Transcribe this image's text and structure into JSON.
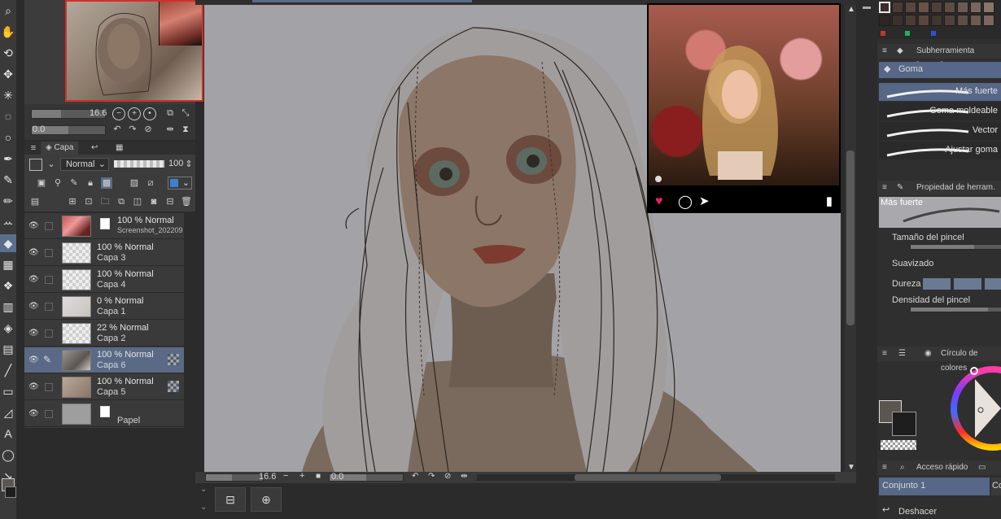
{
  "toolbar": {
    "tools": [
      {
        "name": "zoom-icon",
        "glyph": "⌕"
      },
      {
        "name": "hand-icon",
        "glyph": "✋"
      },
      {
        "name": "rotate-icon",
        "glyph": "⟲"
      },
      {
        "name": "move-icon",
        "glyph": "✥"
      },
      {
        "name": "sparkle-icon",
        "glyph": "✳"
      },
      {
        "name": "lasso-icon",
        "glyph": "◌"
      },
      {
        "name": "ellipse-select-icon",
        "glyph": "○"
      },
      {
        "name": "eyedropper-icon",
        "glyph": "✒"
      },
      {
        "name": "pen-icon",
        "glyph": "✎"
      },
      {
        "name": "pencil-icon",
        "glyph": "✏"
      },
      {
        "name": "brush-icon",
        "glyph": "ꕀ"
      },
      {
        "name": "eraser-icon",
        "glyph": "◆"
      },
      {
        "name": "blend-icon",
        "glyph": "▦"
      },
      {
        "name": "decoration-icon",
        "glyph": "❖"
      },
      {
        "name": "airbrush-icon",
        "glyph": "▥"
      },
      {
        "name": "fill-icon",
        "glyph": "◈"
      },
      {
        "name": "gradient-icon",
        "glyph": "▤"
      },
      {
        "name": "line-icon",
        "glyph": "╱"
      },
      {
        "name": "frame-icon",
        "glyph": "▭"
      },
      {
        "name": "ruler-icon",
        "glyph": "◿"
      },
      {
        "name": "text-icon",
        "glyph": "A"
      },
      {
        "name": "balloon-icon",
        "glyph": "◯"
      },
      {
        "name": "correct-line-icon",
        "glyph": "↘"
      }
    ]
  },
  "navigator": {
    "zoom_value": "16.6",
    "rotation_value": "0.0"
  },
  "layer_panel": {
    "tab_label": "Capa",
    "blend_mode": "Normal",
    "opacity": "100"
  },
  "layers": [
    {
      "line1": "100 % Normal",
      "line2": "Screenshot_2022090",
      "thumb": "photo",
      "visible": true,
      "selected": false,
      "editing": false
    },
    {
      "line1": "100 % Normal",
      "line2": "Capa 3",
      "thumb": "empty",
      "visible": true,
      "selected": false,
      "editing": false
    },
    {
      "line1": "100 % Normal",
      "line2": "Capa 4",
      "thumb": "empty",
      "visible": true,
      "selected": false,
      "editing": false
    },
    {
      "line1": "0 % Normal",
      "line2": "Capa 1",
      "thumb": "sketch",
      "visible": true,
      "selected": false,
      "editing": false
    },
    {
      "line1": "22 % Normal",
      "line2": "Capa 2",
      "thumb": "empty",
      "visible": true,
      "selected": false,
      "editing": false
    },
    {
      "line1": "100 % Normal",
      "line2": "Capa 6",
      "thumb": "lineart",
      "visible": true,
      "selected": true,
      "editing": true
    },
    {
      "line1": "100 % Normal",
      "line2": "Capa 5",
      "thumb": "color",
      "visible": true,
      "selected": false,
      "editing": false
    },
    {
      "line1": "",
      "line2": "Papel",
      "thumb": "paper",
      "visible": true,
      "selected": false,
      "editing": false
    }
  ],
  "canvas_status": {
    "zoom": "16.6",
    "angle": "0.0"
  },
  "right_panel": {
    "colors": {
      "main": "#5c5650",
      "sub": "#1e1e1e",
      "accent": "#566787"
    },
    "subtool_title": "Subherramienta [Goma]",
    "subtool_group": "Goma",
    "brushes": [
      {
        "label": "Más fuerte",
        "active": true
      },
      {
        "label": "Goma moldeable",
        "active": false
      },
      {
        "label": "Vector",
        "active": false
      },
      {
        "label": "Ajustar goma",
        "active": false
      }
    ],
    "tool_property_title": "Propiedad de herram. [M",
    "tool_property_preview": "Más fuerte",
    "properties": {
      "brush_size": "Tamaño del pincel",
      "smoothing": "Suavizado",
      "hardness": "Dureza",
      "brush_density": "Densidad del pincel"
    },
    "color_wheel_title": "Círculo de colores",
    "quick_access_title": "Acceso rápido",
    "quick_access_set": "Conjunto 1",
    "quick_access_set_2": "Co",
    "undo_label": "Deshacer"
  }
}
